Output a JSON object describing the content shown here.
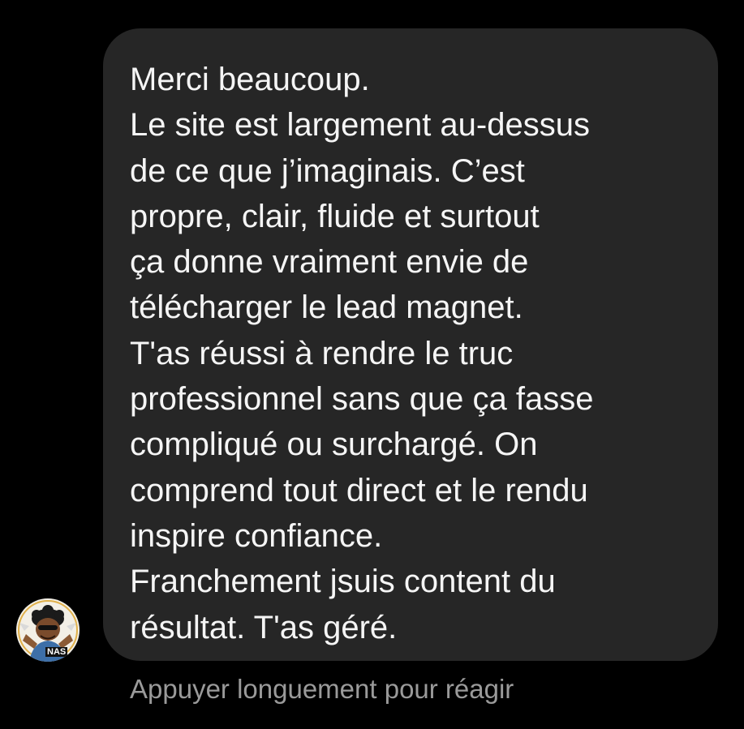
{
  "message": {
    "lines": [
      "Merci beaucoup.",
      "Le site est largement au-dessus",
      "de ce que j’imaginais. C’est",
      "propre, clair, fluide et surtout",
      "ça donne vraiment envie de",
      "télécharger le lead magnet.",
      "T'as réussi à rendre le truc",
      "professionnel sans que ça fasse",
      "compliqué ou surchargé. On",
      "comprend tout direct et le rendu",
      "inspire confiance.",
      "Franchement jsuis content du",
      "résultat. T'as géré."
    ]
  },
  "sender": {
    "avatar_icon": "profile-avatar-cartoon",
    "avatar_badge": "NAS"
  },
  "hint": "Appuyer longuement pour réagir",
  "colors": {
    "background": "#000000",
    "bubble": "#262626",
    "text": "#f5f5f5",
    "hint": "#9a9a9a"
  }
}
